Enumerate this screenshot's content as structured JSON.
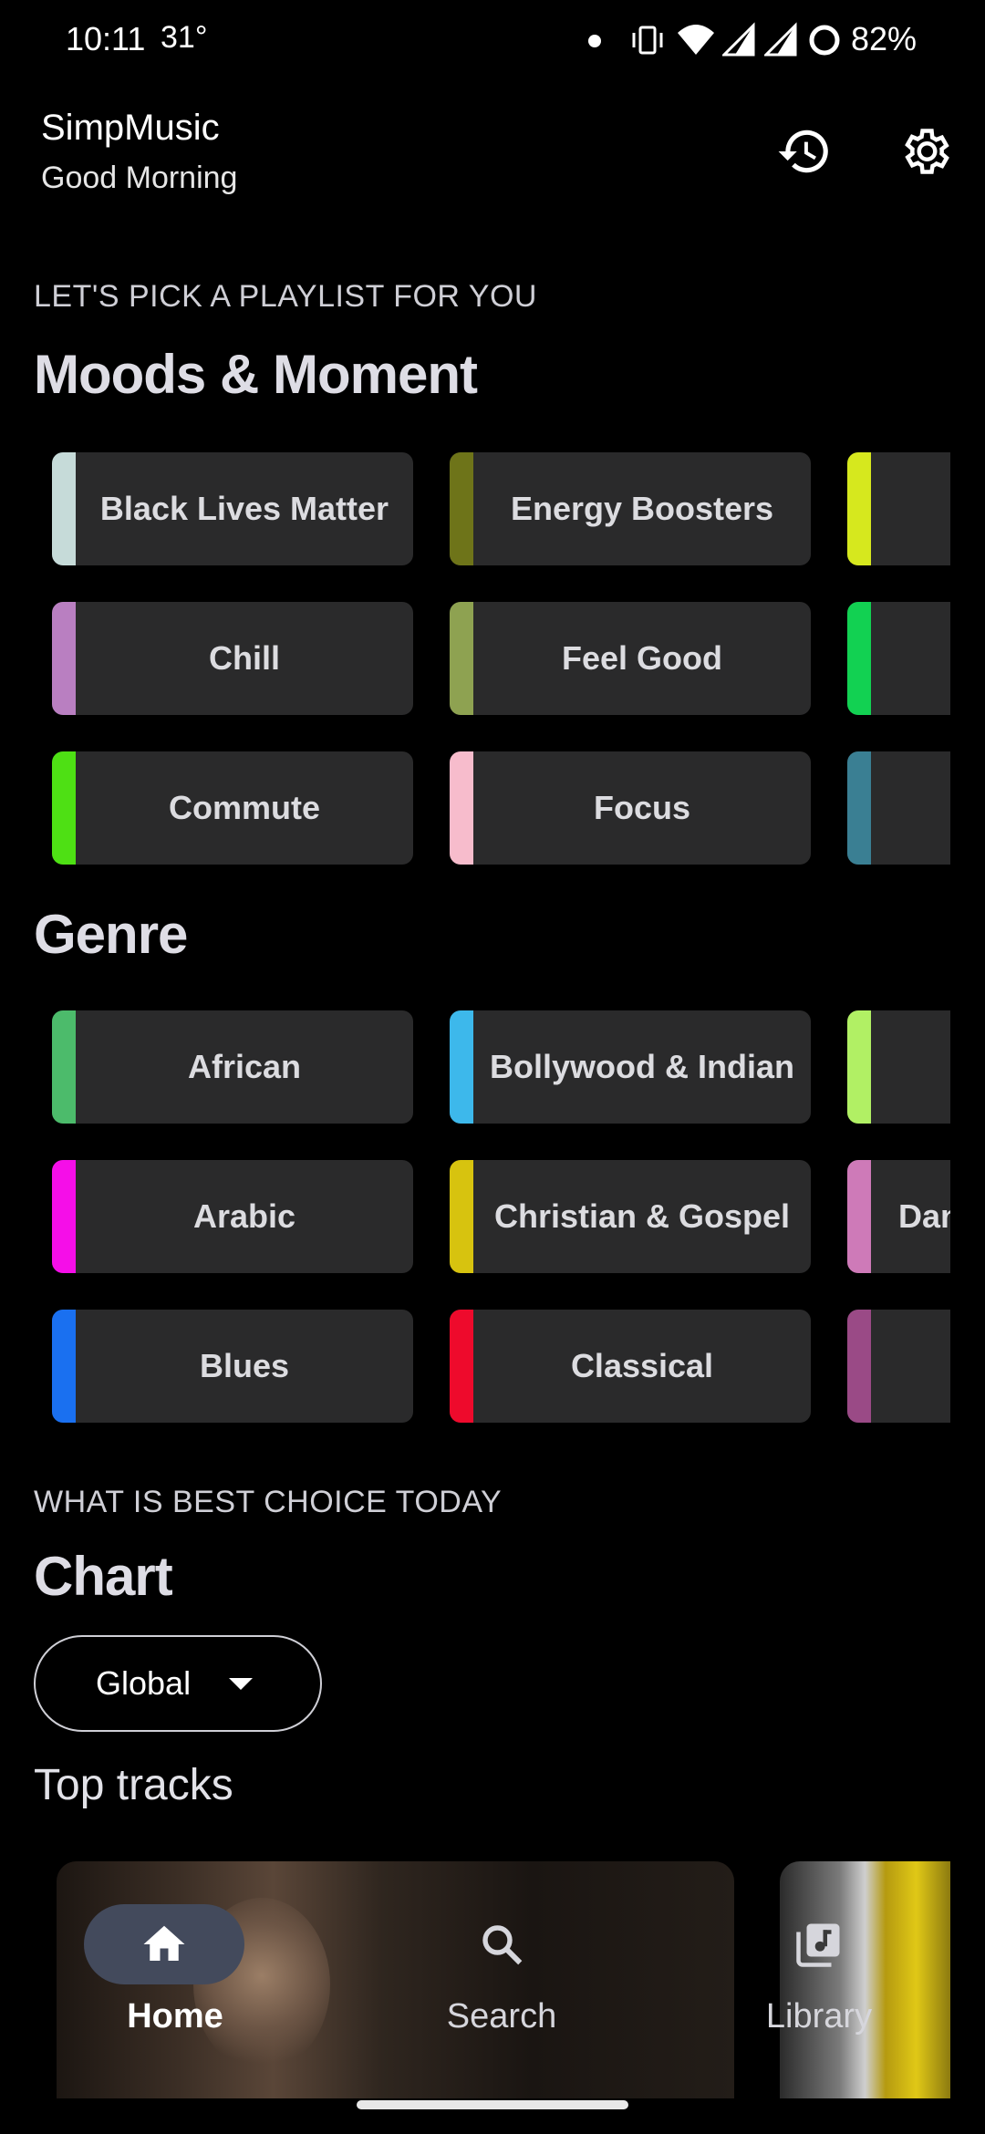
{
  "status_bar": {
    "time": "10:11",
    "temperature": "31°",
    "battery": "82%",
    "icons": [
      "notification-dot-icon",
      "vibrate-icon",
      "wifi-icon",
      "signal-icon",
      "signal-icon",
      "battery-ring-icon"
    ]
  },
  "header": {
    "app_title": "SimpMusic",
    "greeting": "Good Morning",
    "actions": [
      "history-icon",
      "settings-gear-icon"
    ]
  },
  "moods": {
    "overline": "LET'S PICK A PLAYLIST FOR YOU",
    "title": "Moods & Moment",
    "columns": [
      [
        {
          "label": "Black Lives Matter",
          "color": "#c6dbd9"
        },
        {
          "label": "Chill",
          "color": "#b97fc1"
        },
        {
          "label": "Commute",
          "color": "#4ee014"
        }
      ],
      [
        {
          "label": "Energy Boosters",
          "color": "#6e7419"
        },
        {
          "label": "Feel Good",
          "color": "#8ea251"
        },
        {
          "label": "Focus",
          "color": "#f7bccc"
        }
      ],
      [
        {
          "label": "",
          "color": "#d6e81e"
        },
        {
          "label": "",
          "color": "#12d152"
        },
        {
          "label": "",
          "color": "#3a7f93"
        }
      ]
    ]
  },
  "genre": {
    "title": "Genre",
    "columns": [
      [
        {
          "label": "African",
          "color": "#4cbb6b"
        },
        {
          "label": "Arabic",
          "color": "#f50ee8"
        },
        {
          "label": "Blues",
          "color": "#1a70f0"
        }
      ],
      [
        {
          "label": "Bollywood & Indian",
          "color": "#3db8eb"
        },
        {
          "label": "Christian & Gospel",
          "color": "#d7c30f"
        },
        {
          "label": "Classical",
          "color": "#ee0a2c"
        }
      ],
      [
        {
          "label": "",
          "color": "#b1f064"
        },
        {
          "label": "Dan",
          "color": "#ce7ab8"
        },
        {
          "label": "",
          "color": "#9a4a86"
        }
      ]
    ]
  },
  "chart": {
    "overline": "WHAT IS BEST CHOICE TODAY",
    "title": "Chart",
    "country_selected": "Global",
    "subhead": "Top tracks"
  },
  "bottom_nav": {
    "items": [
      {
        "label": "Home",
        "icon": "home-icon",
        "active": true
      },
      {
        "label": "Search",
        "icon": "search-icon",
        "active": false
      },
      {
        "label": "Library",
        "icon": "library-music-icon",
        "active": false
      }
    ]
  }
}
